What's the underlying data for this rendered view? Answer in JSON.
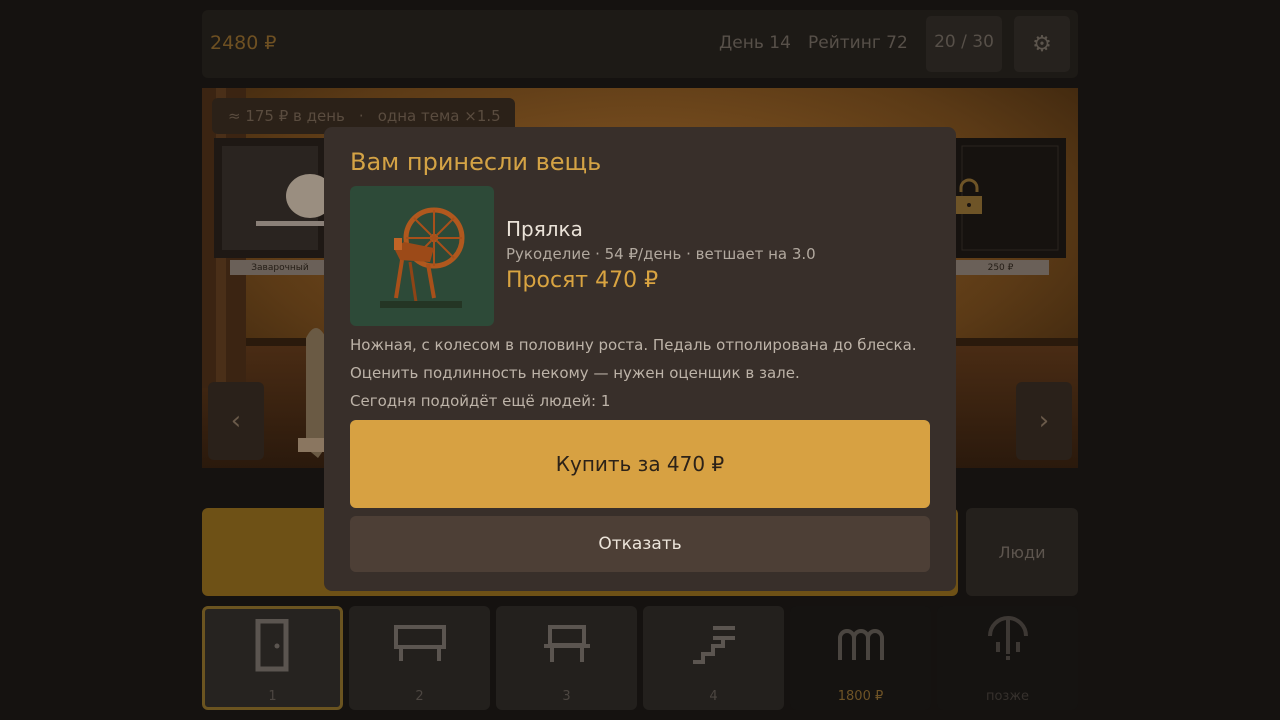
{
  "topbar": {
    "money": "2480 ₽",
    "day": "День 14",
    "rating": "Рейтинг 72",
    "capacity": "20 / 30",
    "settings_icon": "gear-icon"
  },
  "scene": {
    "income": "≈ 175 ₽ в день",
    "separator": "·",
    "theme_bonus": "одна тема ×1.5",
    "shelf_left_tag": "Заварочный",
    "shelf_right_tag": "250 ₽",
    "locked_icon": "lock-icon"
  },
  "modal": {
    "title": "Вам принесли вещь",
    "item_icon": "spinning-wheel-icon",
    "item_name": "Прялка",
    "item_meta": "Рукоделие · 54 ₽/день · ветшает на 3.0",
    "price": "Просят 470 ₽",
    "description": [
      "Ножная, с колесом в половину роста. Педаль отполирована до блеска.",
      "Оценить подлинность некому — нужен оценщик в зале.",
      "Сегодня подойдёт ещё людей: 1"
    ],
    "buy_label": "Купить за 470 ₽",
    "decline_label": "Отказать"
  },
  "bottom": {
    "people_label": "Люди",
    "slots": [
      {
        "label": "1",
        "icon": "door-icon",
        "active": true
      },
      {
        "label": "2",
        "icon": "table-icon"
      },
      {
        "label": "3",
        "icon": "bench-icon"
      },
      {
        "label": "4",
        "icon": "stairs-icon"
      },
      {
        "label": "1800 ₽",
        "icon": "arches-icon"
      },
      {
        "label": "позже",
        "icon": "chandelier-icon",
        "locked": true
      }
    ]
  },
  "colors": {
    "accent": "#d7a142",
    "modal_bg": "#382f2a",
    "page_bg": "#151210"
  }
}
